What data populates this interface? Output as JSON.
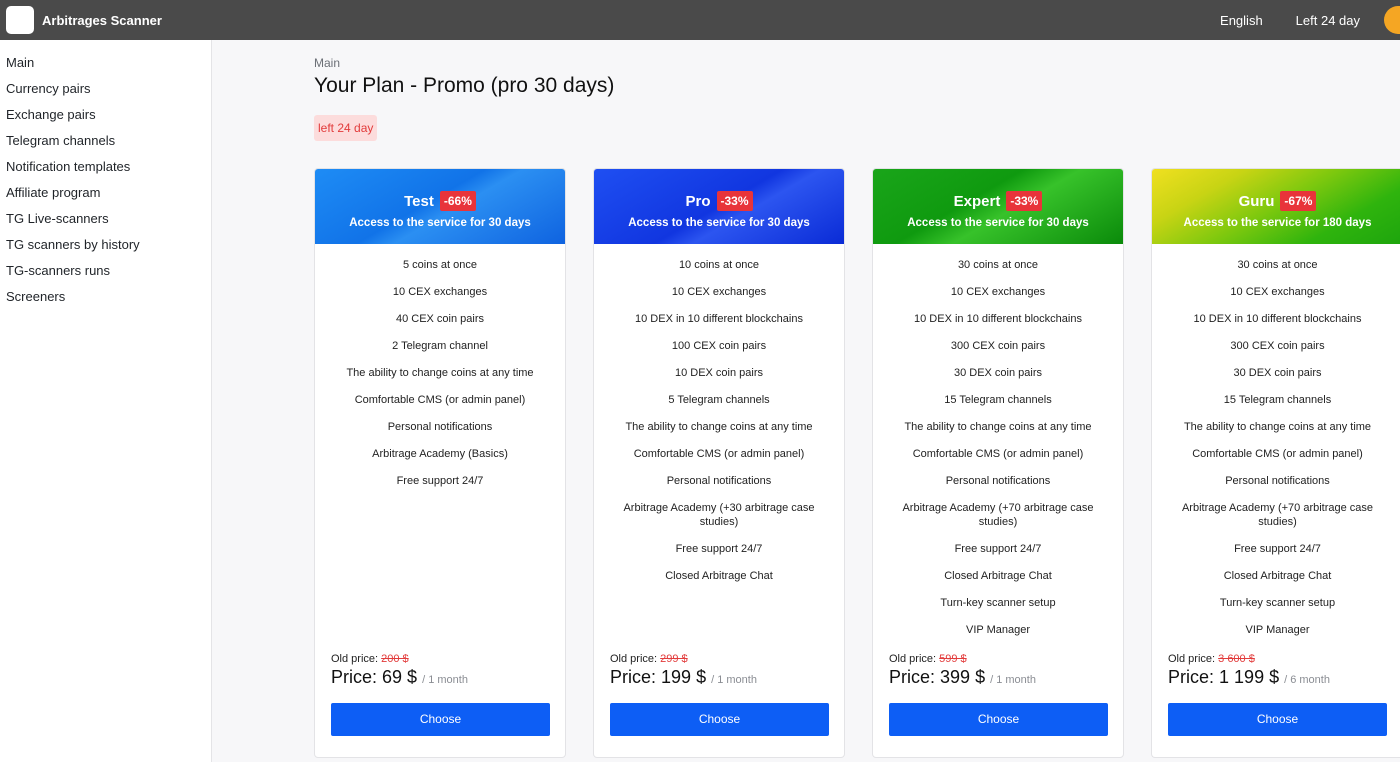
{
  "app": {
    "title": "Arbitrages Scanner",
    "language": "English",
    "left_days": "Left 24 day"
  },
  "sidebar": {
    "items": [
      {
        "label": "Main"
      },
      {
        "label": "Currency pairs"
      },
      {
        "label": "Exchange pairs"
      },
      {
        "label": "Telegram channels"
      },
      {
        "label": "Notification templates"
      },
      {
        "label": "Affiliate program"
      },
      {
        "label": "TG Live-scanners"
      },
      {
        "label": "TG scanners by history"
      },
      {
        "label": "TG-scanners runs"
      },
      {
        "label": "Screeners"
      }
    ]
  },
  "main": {
    "breadcrumb": "Main",
    "title": "Your Plan - Promo (pro 30 days)",
    "left_badge": "left 24 day",
    "old_price_label": "Old price:",
    "price_label": "Price:",
    "choose_label": "Choose",
    "plans": [
      {
        "name": "Test",
        "discount": "-66%",
        "subtitle": "Access to the service for 30 days",
        "features": [
          "5 coins at once",
          "10 CEX exchanges",
          "40 CEX coin pairs",
          "2 Telegram channel",
          "The ability to change coins at any time",
          "Comfortable CMS (or admin panel)",
          "Personal notifications",
          "Arbitrage Academy (Basics)",
          "Free support 24/7"
        ],
        "old_price": "200 $",
        "price": "69 $",
        "period": "/ 1 month"
      },
      {
        "name": "Pro",
        "discount": "-33%",
        "subtitle": "Access to the service for 30 days",
        "features": [
          "10 coins at once",
          "10 CEX exchanges",
          "10 DEX in 10 different blockchains",
          "100 CEX coin pairs",
          "10 DEX coin pairs",
          "5 Telegram channels",
          "The ability to change coins at any time",
          "Comfortable CMS (or admin panel)",
          "Personal notifications",
          "Arbitrage Academy (+30 arbitrage case studies)",
          "Free support 24/7",
          "Closed Arbitrage Chat"
        ],
        "old_price": "299 $",
        "price": "199 $",
        "period": "/ 1 month"
      },
      {
        "name": "Expert",
        "discount": "-33%",
        "subtitle": "Access to the service for 30 days",
        "features": [
          "30 coins at once",
          "10 CEX exchanges",
          "10 DEX in 10 different blockchains",
          "300 CEX coin pairs",
          "30 DEX coin pairs",
          "15 Telegram channels",
          "The ability to change coins at any time",
          "Comfortable CMS (or admin panel)",
          "Personal notifications",
          "Arbitrage Academy (+70 arbitrage case studies)",
          "Free support 24/7",
          "Closed Arbitrage Chat",
          "Turn-key scanner setup",
          "VIP Manager"
        ],
        "old_price": "599 $",
        "price": "399 $",
        "period": "/ 1 month"
      },
      {
        "name": "Guru",
        "discount": "-67%",
        "subtitle": "Access to the service for 180 days",
        "features": [
          "30 coins at once",
          "10 CEX exchanges",
          "10 DEX in 10 different blockchains",
          "300 CEX coin pairs",
          "30 DEX coin pairs",
          "15 Telegram channels",
          "The ability to change coins at any time",
          "Comfortable CMS (or admin panel)",
          "Personal notifications",
          "Arbitrage Academy (+70 arbitrage case studies)",
          "Free support 24/7",
          "Closed Arbitrage Chat",
          "Turn-key scanner setup",
          "VIP Manager"
        ],
        "old_price": "3 600 $",
        "price": "1 199 $",
        "period": "/ 6 month"
      }
    ]
  },
  "colors": {
    "topbar": "#4a4a4a",
    "choose_button": "#0d5ef5",
    "discount_badge": "#e8343a",
    "old_price": "#e23b3b"
  }
}
